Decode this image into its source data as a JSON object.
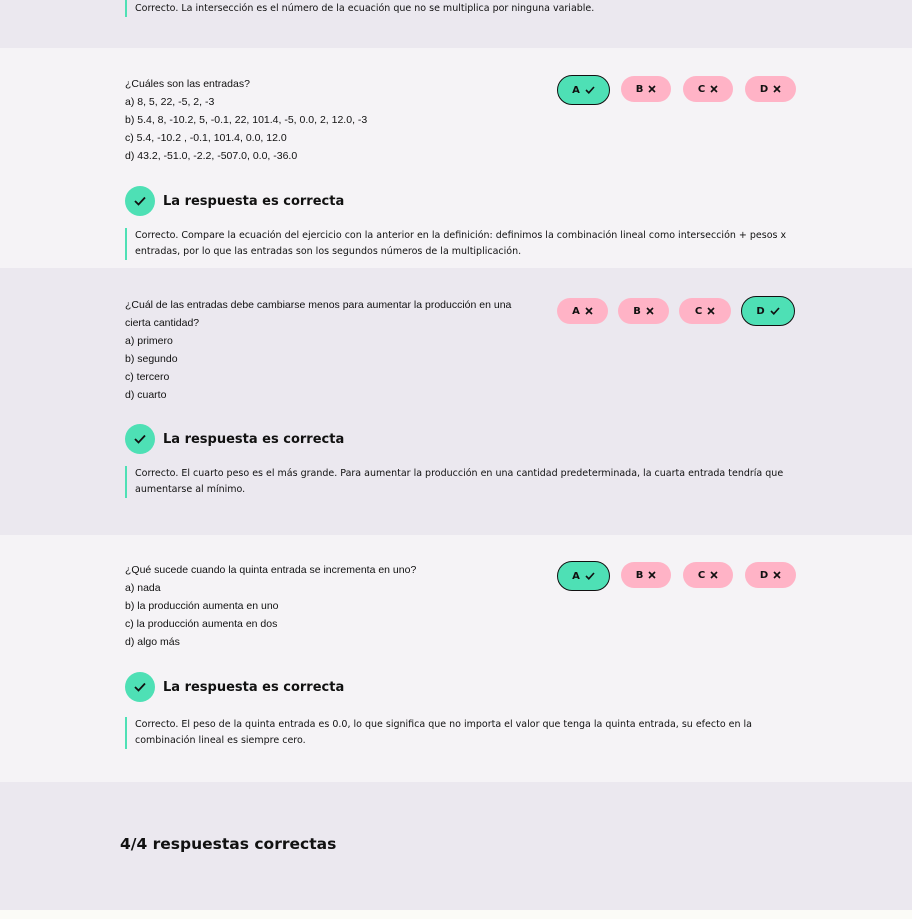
{
  "top_feedback": "Correcto. La intersección es el número de la ecuación que no se multiplica por ninguna variable.",
  "questions": [
    {
      "lines": [
        "¿Cuáles son las entradas?",
        "a) 8, 5, 22, -5, 2, -3",
        "b) 5.4, 8, -10.2, 5, -0.1, 22, 101.4, -5, 0.0, 2, 12.0, -3",
        "c) 5.4, -10.2 , -0.1, 101.4, 0.0, 12.0",
        "d) 43.2, -51.0, -2.2, -507.0, 0.0, -36.0"
      ],
      "choices": [
        {
          "label": "A",
          "state": "selected-correct",
          "icon": "check-icon"
        },
        {
          "label": "B",
          "state": "incorrect",
          "icon": "x-icon"
        },
        {
          "label": "C",
          "state": "incorrect",
          "icon": "x-icon"
        },
        {
          "label": "D",
          "state": "incorrect",
          "icon": "x-icon"
        }
      ],
      "verdict": "La respuesta es correcta",
      "feedback": "Correcto. Compare la ecuación del ejercicio con la anterior en la definición: definimos la combinación lineal como intersección + pesos x entradas, por lo que las entradas son los segundos números de la multiplicación."
    },
    {
      "lines": [
        "¿Cuál de las entradas debe cambiarse menos para aumentar la producción en una",
        "cierta cantidad?",
        "a) primero",
        "b) segundo",
        "c) tercero",
        "d) cuarto"
      ],
      "choices": [
        {
          "label": "A",
          "state": "incorrect",
          "icon": "x-icon"
        },
        {
          "label": "B",
          "state": "incorrect",
          "icon": "x-icon"
        },
        {
          "label": "C",
          "state": "incorrect",
          "icon": "x-icon"
        },
        {
          "label": "D",
          "state": "selected-correct",
          "icon": "check-icon"
        }
      ],
      "verdict": "La respuesta es correcta",
      "feedback": "Correcto. El cuarto peso es el más grande. Para aumentar la producción en una cantidad predeterminada, la cuarta entrada tendría que aumentarse al mínimo."
    },
    {
      "lines": [
        "¿Qué sucede cuando la quinta entrada se incrementa en uno?",
        "a) nada",
        "b) la producción aumenta en uno",
        "c) la producción aumenta en dos",
        "d) algo más"
      ],
      "choices": [
        {
          "label": "A",
          "state": "selected-correct",
          "icon": "check-icon"
        },
        {
          "label": "B",
          "state": "incorrect",
          "icon": "x-icon"
        },
        {
          "label": "C",
          "state": "incorrect",
          "icon": "x-icon"
        },
        {
          "label": "D",
          "state": "incorrect",
          "icon": "x-icon"
        }
      ],
      "verdict": "La respuesta es correcta",
      "feedback": "Correcto. El peso de la quinta entrada es 0.0, lo que significa que no importa el valor que tenga la quinta entrada, su efecto en la combinación lineal es siempre cero."
    }
  ],
  "score": "4/4 respuestas correctas",
  "colors": {
    "correct": "#4ee0b5",
    "incorrect": "#ffb3c6"
  }
}
